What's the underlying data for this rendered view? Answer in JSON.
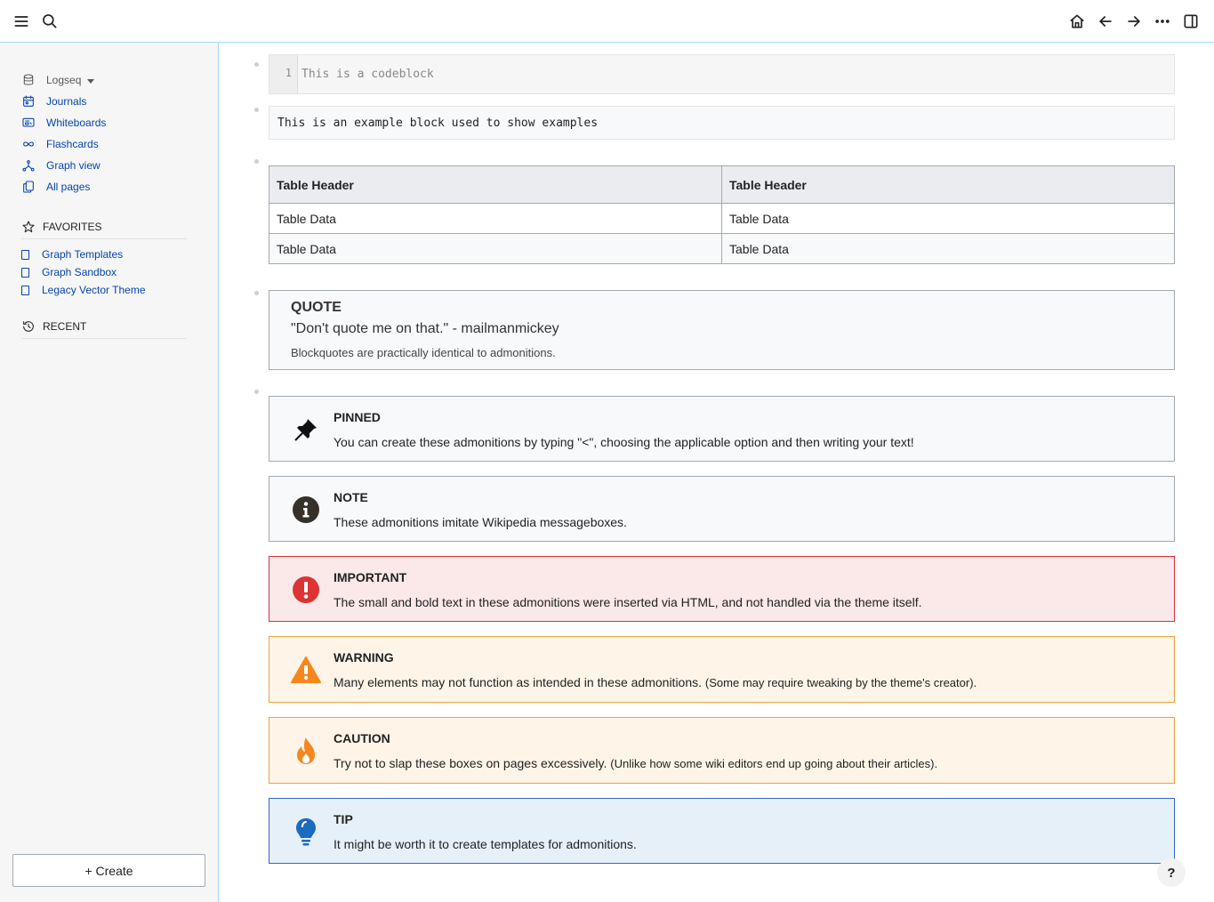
{
  "header": {
    "menu_icon": "menu-icon",
    "search_icon": "search-icon",
    "home_icon": "home-icon",
    "back_icon": "arrow-left-icon",
    "forward_icon": "arrow-right-icon",
    "more_icon": "more-icon",
    "sidebar_toggle_icon": "right-sidebar-icon"
  },
  "sidebar": {
    "graph_name": "Logseq",
    "nav": [
      {
        "label": "Journals",
        "icon": "calendar-icon"
      },
      {
        "label": "Whiteboards",
        "icon": "whiteboard-icon"
      },
      {
        "label": "Flashcards",
        "icon": "infinity-icon"
      },
      {
        "label": "Graph view",
        "icon": "graph-icon"
      },
      {
        "label": "All pages",
        "icon": "pages-icon"
      }
    ],
    "favorites_label": "FAVORITES",
    "favorites": [
      "Graph Templates",
      "Graph Sandbox",
      "Legacy Vector Theme"
    ],
    "recent_label": "RECENT",
    "create_label": "+ Create"
  },
  "main": {
    "codeblock": {
      "line_number": "1",
      "text": "This is a codeblock"
    },
    "example": "This is an example block used to show examples",
    "table": {
      "headers": [
        "Table Header",
        "Table Header"
      ],
      "rows": [
        [
          "Table Data",
          "Table Data"
        ],
        [
          "Table Data",
          "Table Data"
        ]
      ]
    },
    "quote": {
      "title": "QUOTE",
      "body": "\"Don't quote me on that.\" - mailmanmickey",
      "note": "Blockquotes are practically identical to admonitions."
    },
    "admonitions": [
      {
        "type": "pinned",
        "icon": "pin-icon",
        "title": "PINNED",
        "body": "You can create these admonitions by typing \"<\", choosing the applicable option and then writing your text!",
        "small": ""
      },
      {
        "type": "note",
        "icon": "info-icon",
        "title": "NOTE",
        "body": "These admonitions imitate Wikipedia messageboxes.",
        "small": ""
      },
      {
        "type": "important",
        "icon": "exclamation-icon",
        "title": "IMPORTANT",
        "body": "The small and bold text in these admonitions were inserted via HTML, and not handled via the theme itself.",
        "small": ""
      },
      {
        "type": "warning",
        "icon": "warning-triangle-icon",
        "title": "WARNING",
        "body": "Many elements may not function as intended in these admonitions.",
        "small": "(Some may require tweaking by the theme's creator)."
      },
      {
        "type": "caution",
        "icon": "flame-icon",
        "title": "CAUTION",
        "body": "Try not to slap these boxes on pages excessively.",
        "small": "(Unlike how some wiki editors end up going about their articles)."
      },
      {
        "type": "tip",
        "icon": "lightbulb-icon",
        "title": "TIP",
        "body": "It might be worth it to create templates for admonitions.",
        "small": ""
      }
    ]
  },
  "help_label": "?",
  "colors": {
    "link": "#0645ad",
    "border": "#a2a9b1",
    "important_red": "#dd3333",
    "warning_orange": "#f6871f",
    "tip_blue": "#3366cc"
  }
}
